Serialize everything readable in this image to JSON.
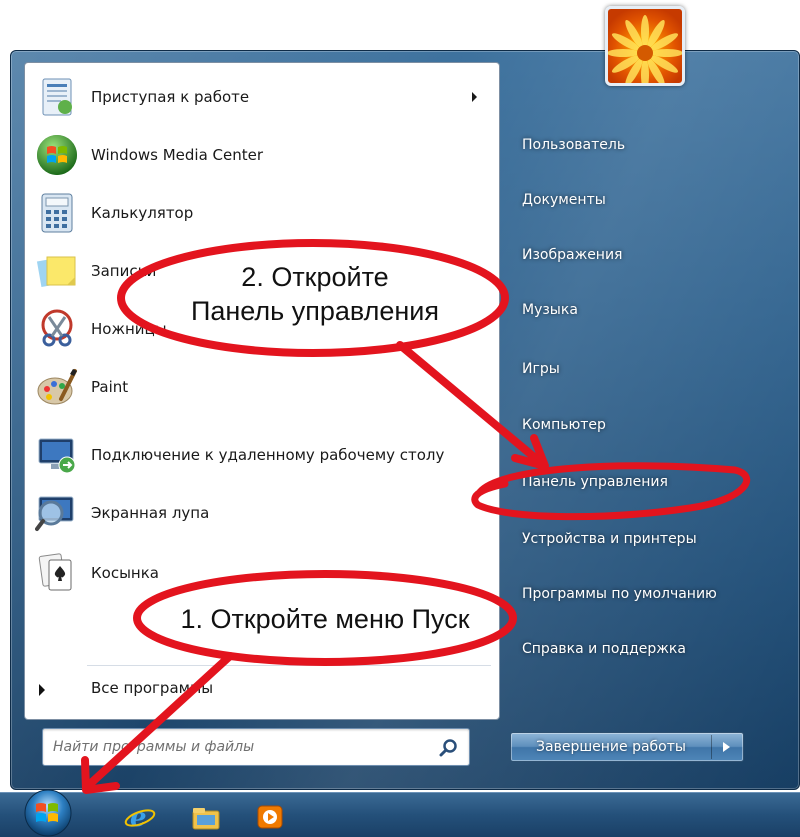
{
  "programs": [
    {
      "label": "Приступая к работе",
      "icon": "getting-started-icon",
      "has_submenu": true
    },
    {
      "label": "Windows Media Center",
      "icon": "windows-media-center-icon"
    },
    {
      "label": "Калькулятор",
      "icon": "calculator-icon"
    },
    {
      "label": "Записки",
      "icon": "sticky-notes-icon"
    },
    {
      "label": "Ножницы",
      "icon": "snipping-tool-icon"
    },
    {
      "label": "Paint",
      "icon": "paint-icon"
    },
    {
      "label": "Подключение к удаленному рабочему столу",
      "icon": "remote-desktop-icon"
    },
    {
      "label": "Экранная лупа",
      "icon": "magnifier-icon"
    },
    {
      "label": "Косынка",
      "icon": "solitaire-icon"
    }
  ],
  "all_programs_label": "Все программы",
  "search": {
    "placeholder": "Найти программы и файлы"
  },
  "right_column": [
    "Пользователь",
    "Документы",
    "Изображения",
    "Музыка",
    "Игры",
    "Компьютер",
    "Панель управления",
    "Устройства и принтеры",
    "Программы по умолчанию",
    "Справка и поддержка"
  ],
  "shutdown_label": "Завершение работы",
  "annotations": {
    "step2_line1": "2. Откройте",
    "step2_line2": "Панель управления",
    "step1": "1. Откройте меню Пуск"
  },
  "colors": {
    "annotation_red": "#e3141e",
    "menu_glass": "#2b5f8c",
    "taskbar": "#24507a"
  }
}
